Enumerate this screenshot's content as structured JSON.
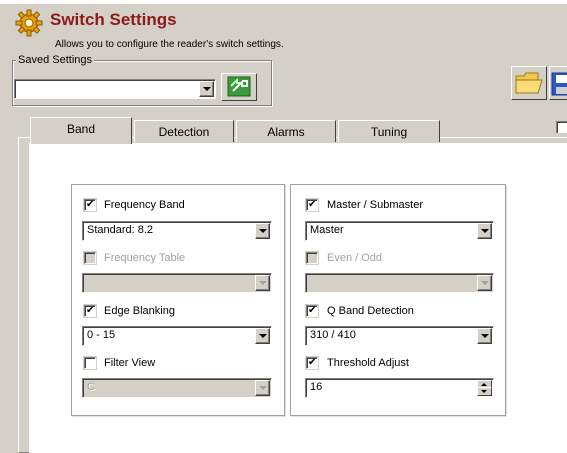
{
  "header": {
    "title": "Switch Settings",
    "subtitle": "Allows you to configure the reader's switch settings."
  },
  "saved_settings": {
    "legend": "Saved Settings",
    "value": ""
  },
  "tabs": [
    {
      "label": "Band",
      "active": true
    },
    {
      "label": "Detection",
      "active": false
    },
    {
      "label": "Alarms",
      "active": false
    },
    {
      "label": "Tuning",
      "active": false
    }
  ],
  "left_panel": {
    "frequency_band": {
      "label": "Frequency Band",
      "checked": true,
      "value": "Standard: 8.2"
    },
    "frequency_table": {
      "label": "Frequency Table",
      "checked": false,
      "enabled": false,
      "value": ""
    },
    "edge_blanking": {
      "label": "Edge Blanking",
      "checked": true,
      "value": "0 - 15"
    },
    "filter_view": {
      "label": "Filter View",
      "checked": false,
      "value": "C"
    }
  },
  "right_panel": {
    "master_submaster": {
      "label": "Master / Submaster",
      "checked": true,
      "value": "Master"
    },
    "even_odd": {
      "label": "Even / Odd",
      "checked": false,
      "enabled": false,
      "value": ""
    },
    "q_band_detection": {
      "label": "Q Band Detection",
      "checked": true,
      "value": "310 / 410"
    },
    "threshold_adjust": {
      "label": "Threshold Adjust",
      "checked": true,
      "value": "16"
    }
  },
  "colors": {
    "title": "#8b1a1a",
    "window_bg": "#d4d0c8",
    "panel_bg": "#ffffff"
  },
  "icons": {
    "header": "gear-icon",
    "load": "green-arrow-icon",
    "open": "folder-icon",
    "save": "floppy-disk-icon"
  }
}
